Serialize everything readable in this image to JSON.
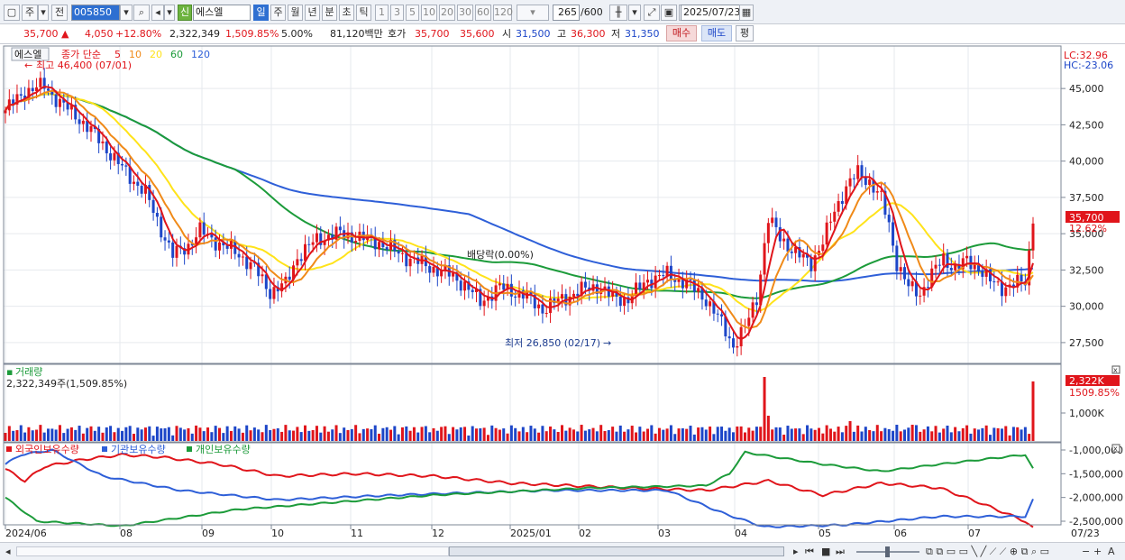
{
  "toolbar": {
    "market": "주",
    "period_mode": "전",
    "code": "005850",
    "badge": "신",
    "stock_name": "에스엘",
    "period_tabs": [
      "일",
      "주",
      "월",
      "년",
      "분",
      "초",
      "틱"
    ],
    "active_period": "일",
    "intervals": [
      "1",
      "3",
      "5",
      "10",
      "20",
      "30",
      "60",
      "120"
    ],
    "count": "265",
    "total": "/600",
    "date": "2025/07/23"
  },
  "quote": {
    "price": "35,700",
    "change": "4,050",
    "change_pct": "+12.80%",
    "volume": "2,322,349",
    "volume_pct": "1,509.85%",
    "turnover_pct": "5.00%",
    "amount": "81,120백만",
    "bid_label": "호가",
    "ask": "35,700",
    "bid": "35,600",
    "open_label": "시",
    "open": "31,500",
    "high_label": "고",
    "high": "36,300",
    "low_label": "저",
    "low": "31,350",
    "buy_button": "매수",
    "sell_button": "매도",
    "eval_button": "평"
  },
  "price_panel": {
    "name": "에스엘",
    "ma_title": "종가 단순",
    "ma_labels": [
      {
        "label": "5",
        "color": "#e0151b"
      },
      {
        "label": "10",
        "color": "#f08a18"
      },
      {
        "label": "20",
        "color": "#ffe31a"
      },
      {
        "label": "60",
        "color": "#1c9b3a"
      },
      {
        "label": "120",
        "color": "#2e5fd8"
      }
    ],
    "high_annot": "최고 46,400 (07/01)",
    "low_annot": "최저 26,850 (02/17)",
    "dividend_annot": "배당락(0.00%)",
    "lc": "LC:32.96",
    "hc": "HC:-23.06",
    "y_ticks": [
      "45,000",
      "42,500",
      "40,000",
      "37,500",
      "35,000",
      "32,500",
      "30,000",
      "27,500"
    ],
    "price_tag": "35,700",
    "pct_tag": "12.62%"
  },
  "volume_panel": {
    "title": "거래량",
    "value": "2,322,349주(1,509.85%)",
    "tag": "2,322K",
    "tag_pct": "1509.85%",
    "y_tick": "1,000K"
  },
  "holdings_panel": {
    "legends": [
      {
        "label": "외국인보유수량",
        "color": "#e0151b"
      },
      {
        "label": "기관보유수량",
        "color": "#2e5fd8"
      },
      {
        "label": "개인보유수량",
        "color": "#1c9b3a"
      }
    ],
    "y_ticks": [
      "-1,000,000",
      "-1,500,000",
      "-2,000,000",
      "-2,500,000"
    ]
  },
  "x_axis": [
    "2024/06",
    "08",
    "09",
    "10",
    "11",
    "12",
    "2025/01",
    "02",
    "03",
    "04",
    "05",
    "06",
    "07"
  ],
  "x_axis_end": "07/23",
  "colors": {
    "up": "#e0151b",
    "down": "#1d46c8",
    "ma5": "#e0151b",
    "ma10": "#f08a18",
    "ma20": "#ffe31a",
    "ma60": "#1c9b3a",
    "ma120": "#2e5fd8"
  }
}
